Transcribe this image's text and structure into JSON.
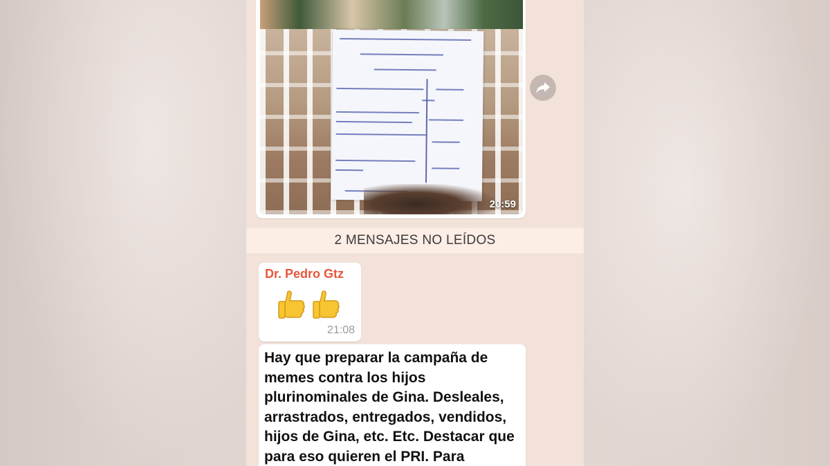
{
  "photo_message": {
    "time": "20:59"
  },
  "unread_divider": {
    "label": "2 MENSAJES NO LEÍDOS"
  },
  "emoji_message": {
    "sender": "Dr. Pedro Gtz",
    "emoji": "👍👍",
    "time": "21:08"
  },
  "text_message": {
    "text": "Hay que preparar la campaña de memes contra los hijos plurinominales de Gina. Desleales, arrastrados, entregados, vendidos, hijos de Gina, etc. Etc. Destacar que para eso quieren el PRI. Para"
  },
  "colors": {
    "chat_background": "#f2e2d9",
    "sender_name": "#e8563a",
    "bubble": "#ffffff"
  },
  "icons": {
    "forward": "forward-arrow-icon",
    "thumbs_up": "thumbs-up-icon"
  }
}
